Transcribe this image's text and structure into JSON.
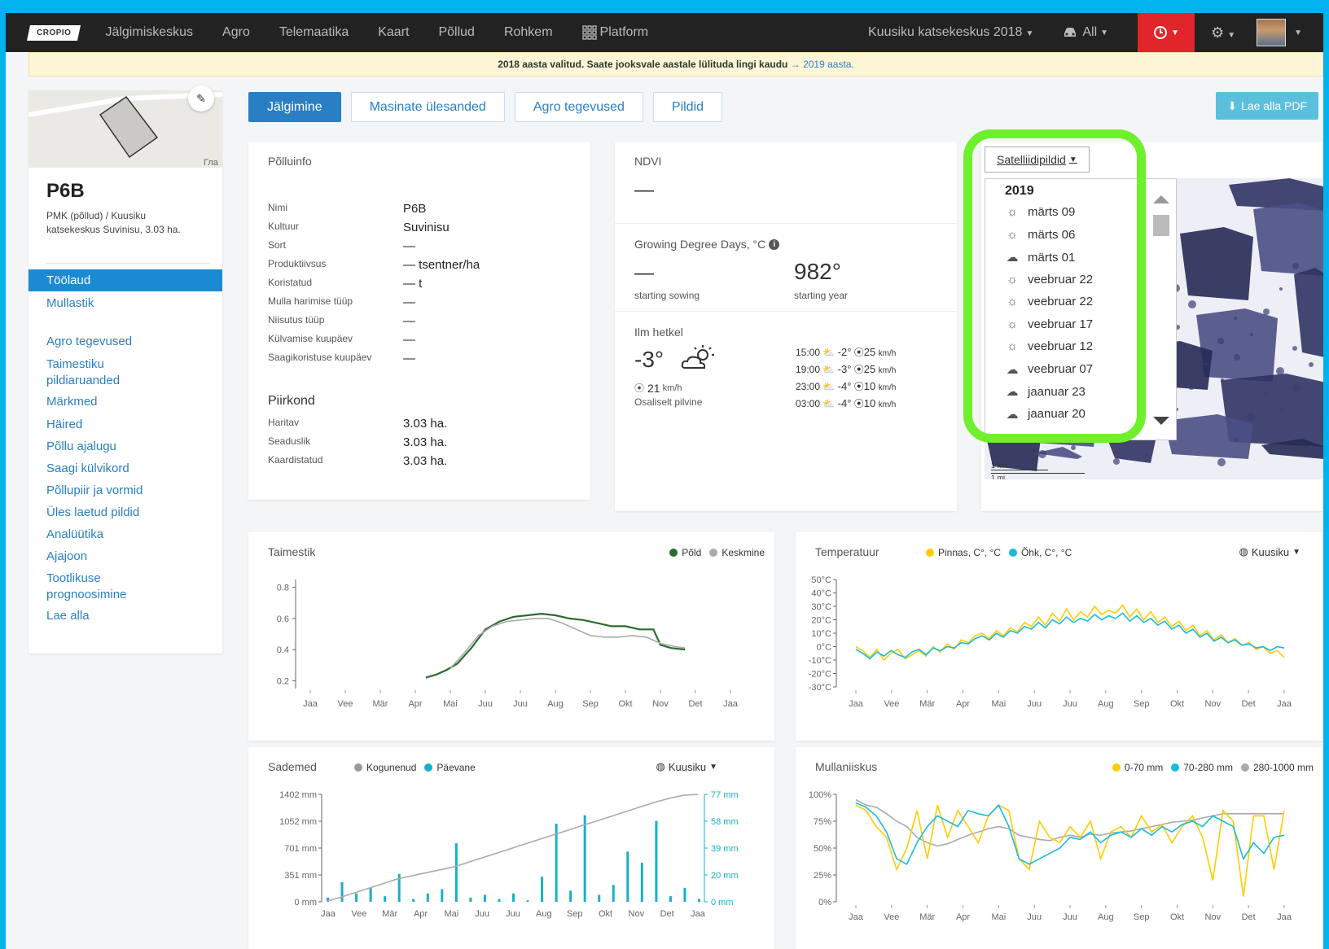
{
  "navbar": {
    "logo": "CROPIO",
    "items": [
      "Jälgimiskeskus",
      "Agro",
      "Telemaatika",
      "Kaart",
      "Põllud",
      "Rohkem"
    ],
    "platform": "Platform",
    "season": "Kuusiku katsekeskus 2018",
    "vehicles": "All"
  },
  "yearbar": {
    "text": "2018 aasta valitud. Saate jooksvale aastale lülituda lingi kaudu",
    "arrow": "→",
    "link": "2019 aasta."
  },
  "sidebar": {
    "field_name": "P6B",
    "subtitle": "PMK (põllud) / Kuusiku katsekeskus Suvinisu, 3.03 ha.",
    "map_label": "Гла",
    "menu": [
      "Töölaud",
      "Mullastik",
      "Agro tegevused",
      "Taimestiku pildiaruanded",
      "Märkmed",
      "Häired",
      "Põllu ajalugu",
      "Saagi külvikord",
      "Põllupiir ja vormid",
      "Üles laetud pildid",
      "Analüütika",
      "Ajajoon",
      "Tootlikuse prognoosimine",
      "Lae alla"
    ]
  },
  "tabs": [
    "Jälgimine",
    "Masinate ülesanded",
    "Agro tegevused",
    "Pildid"
  ],
  "pdf_button": "Lae alla PDF",
  "field_info": {
    "title": "Põlluinfo",
    "rows": [
      {
        "label": "Nimi",
        "value": "P6B"
      },
      {
        "label": "Kultuur",
        "value": "Suvinisu"
      },
      {
        "label": "Sort",
        "value": "—"
      },
      {
        "label": "Produktiivsus",
        "value": "— tsentner/ha"
      },
      {
        "label": "Koristatud",
        "value": "— t"
      },
      {
        "label": "Mulla harimise tüüp",
        "value": "—"
      },
      {
        "label": "Niisutus tüüp",
        "value": "—"
      },
      {
        "label": "Külvamise kuupäev",
        "value": "—"
      },
      {
        "label": "Saagikoristuse kuupäev",
        "value": "—"
      }
    ],
    "district_title": "Piirkond",
    "district_rows": [
      {
        "label": "Haritav",
        "value": "3.03 ha."
      },
      {
        "label": "Seaduslik",
        "value": "3.03 ha."
      },
      {
        "label": "Kaardistatud",
        "value": "3.03 ha."
      }
    ]
  },
  "ndvi": {
    "title": "NDVI",
    "value": "—",
    "gdd_title": "Growing Degree Days, °C",
    "gdd_sowing_value": "—",
    "gdd_sowing_label": "starting sowing",
    "gdd_year_value": "982°",
    "gdd_year_label": "starting year",
    "weather_title": "Ilm hetkel",
    "weather_temp": "-3°",
    "weather_wind": "21",
    "weather_wind_unit": "km/h",
    "weather_desc": "Osaliselt pilvine",
    "forecast": [
      {
        "time": "15:00",
        "temp": "-2°",
        "wind": "25",
        "unit": "km/h"
      },
      {
        "time": "19:00",
        "temp": "-3°",
        "wind": "25",
        "unit": "km/h"
      },
      {
        "time": "23:00",
        "temp": "-4°",
        "wind": "10",
        "unit": "km/h"
      },
      {
        "time": "03:00",
        "temp": "-4°",
        "wind": "10",
        "unit": "km/h"
      }
    ]
  },
  "satellite": {
    "button": "Satelliidipildid",
    "year": "2019",
    "items": [
      {
        "label": "märts 09",
        "icon": "sun-icon"
      },
      {
        "label": "märts 06",
        "icon": "sun-icon"
      },
      {
        "label": "märts 01",
        "icon": "cloud-icon"
      },
      {
        "label": "veebruar 22",
        "icon": "sun-icon"
      },
      {
        "label": "veebruar 22",
        "icon": "sun-icon"
      },
      {
        "label": "veebruar 17",
        "icon": "sun-icon"
      },
      {
        "label": "veebruar 12",
        "icon": "sun-icon"
      },
      {
        "label": "veebruar 07",
        "icon": "cloud-icon"
      },
      {
        "label": "jaanuar 23",
        "icon": "cloud-icon"
      },
      {
        "label": "jaanuar 20",
        "icon": "cloud-icon"
      }
    ],
    "scale_km": "1 km",
    "scale_mi": "1 mi",
    "highlight_color": "#6ef02d"
  },
  "chart_data": [
    {
      "type": "line",
      "title": "Taimestik",
      "series": [
        {
          "name": "Põld",
          "color": "#2e6b2e",
          "x": [
            3.3,
            3.6,
            3.9,
            4.2,
            4.6,
            5.0,
            5.4,
            5.8,
            6.2,
            6.6,
            7.0,
            7.4,
            7.8,
            8.2,
            8.6,
            9.0,
            9.4,
            9.8,
            10.0,
            10.3,
            10.7
          ],
          "values": [
            0.22,
            0.24,
            0.27,
            0.31,
            0.41,
            0.53,
            0.58,
            0.61,
            0.62,
            0.63,
            0.62,
            0.6,
            0.59,
            0.57,
            0.55,
            0.55,
            0.53,
            0.53,
            0.43,
            0.41,
            0.4
          ]
        },
        {
          "name": "Keskmine",
          "color": "#aaaaaa",
          "x": [
            4.0,
            4.4,
            4.8,
            5.2,
            5.6,
            6.0,
            6.4,
            6.8,
            7.2,
            7.6,
            8.0,
            8.4,
            8.8,
            9.2,
            9.6,
            10.0,
            10.4,
            10.7
          ],
          "values": [
            0.28,
            0.38,
            0.49,
            0.55,
            0.58,
            0.59,
            0.6,
            0.6,
            0.57,
            0.53,
            0.49,
            0.48,
            0.48,
            0.49,
            0.48,
            0.44,
            0.42,
            0.41
          ]
        }
      ],
      "categories": [
        "Jaa",
        "Vee",
        "Mär",
        "Apr",
        "Mai",
        "Juu",
        "Juu",
        "Aug",
        "Sep",
        "Okt",
        "Nov",
        "Det",
        "Jaa"
      ],
      "yticks": [
        0.2,
        0.4,
        0.6,
        0.8
      ],
      "ylim": [
        0.15,
        0.85
      ]
    },
    {
      "type": "line",
      "title": "Temperatuur",
      "location": "Kuusiku",
      "series": [
        {
          "name": "Pinnas, C°, °C",
          "color": "#ffcc00",
          "values": [
            0,
            -3,
            -8,
            -2,
            -10,
            -5,
            -2,
            -9,
            -6,
            -3,
            -7,
            0,
            -4,
            2,
            -2,
            5,
            3,
            8,
            10,
            6,
            12,
            8,
            14,
            11,
            18,
            15,
            22,
            16,
            25,
            19,
            28,
            20,
            26,
            22,
            30,
            24,
            27,
            25,
            31,
            22,
            28,
            20,
            26,
            18,
            22,
            15,
            19,
            12,
            16,
            8,
            12,
            5,
            9,
            3,
            6,
            1,
            3,
            -2,
            0,
            -5,
            -3,
            -8
          ]
        },
        {
          "name": "Õhk, C°, °C",
          "color": "#18bbdd",
          "values": [
            -2,
            -5,
            -9,
            -4,
            -7,
            -3,
            -6,
            -8,
            -4,
            -2,
            -6,
            -1,
            -3,
            0,
            -1,
            3,
            2,
            6,
            8,
            5,
            10,
            7,
            12,
            10,
            15,
            13,
            18,
            14,
            20,
            17,
            22,
            18,
            21,
            19,
            24,
            20,
            23,
            21,
            25,
            19,
            23,
            18,
            21,
            16,
            19,
            13,
            16,
            10,
            13,
            7,
            10,
            4,
            7,
            3,
            5,
            1,
            2,
            -1,
            0,
            -3,
            0,
            -1
          ]
        }
      ],
      "categories": [
        "Jaa",
        "Vee",
        "Mär",
        "Apr",
        "Mai",
        "Juu",
        "Juu",
        "Aug",
        "Sep",
        "Okt",
        "Nov",
        "Det",
        "Jaa"
      ],
      "yticks": [
        "-30°C",
        "-20°C",
        "-10°C",
        "0°C",
        "10°C",
        "20°C",
        "30°C",
        "40°C",
        "50°C"
      ],
      "ylim": [
        -30,
        50
      ]
    },
    {
      "type": "bar",
      "title": "Sademed",
      "location": "Kuusiku",
      "series": [
        {
          "name": "Kogunenud",
          "color": "#999999",
          "values": [
            5,
            60,
            120,
            180,
            240,
            300,
            340,
            380,
            420,
            460,
            520,
            580,
            640,
            700,
            760,
            820,
            880,
            940,
            1000,
            1060,
            1120,
            1180,
            1240,
            1300,
            1350,
            1390,
            1402
          ]
        },
        {
          "name": "Päevane",
          "color": "#18b0c8",
          "values": [
            3,
            14,
            6,
            10,
            4,
            20,
            2,
            6,
            9,
            42,
            3,
            5,
            2,
            6,
            1,
            18,
            56,
            8,
            62,
            5,
            12,
            36,
            28,
            58,
            4,
            10,
            2
          ]
        }
      ],
      "categories": [
        "Jaa",
        "Vee",
        "Mär",
        "Apr",
        "Mai",
        "Juu",
        "Juu",
        "Aug",
        "Sep",
        "Okt",
        "Nov",
        "Det",
        "Jaa"
      ],
      "yticks_left": [
        "0 mm",
        "351 mm",
        "701 mm",
        "1052 mm",
        "1402 mm"
      ],
      "yticks_right": [
        "0 mm",
        "20 mm",
        "39 mm",
        "58 mm",
        "77 mm"
      ]
    },
    {
      "type": "line",
      "title": "Mullaniiskus",
      "series": [
        {
          "name": "0-70 mm",
          "color": "#ffcc00",
          "values": [
            90,
            85,
            70,
            60,
            30,
            50,
            85,
            40,
            90,
            60,
            85,
            70,
            55,
            80,
            90,
            85,
            40,
            30,
            75,
            60,
            55,
            70,
            60,
            75,
            40,
            65,
            70,
            60,
            80,
            65,
            72,
            55,
            70,
            80,
            60,
            20,
            85,
            75,
            5,
            80,
            80,
            30,
            85
          ]
        },
        {
          "name": "70-280 mm",
          "color": "#18bbdd",
          "values": [
            92,
            88,
            80,
            65,
            40,
            35,
            55,
            70,
            80,
            75,
            70,
            85,
            82,
            80,
            90,
            70,
            40,
            35,
            40,
            45,
            50,
            60,
            58,
            65,
            55,
            62,
            65,
            60,
            68,
            62,
            70,
            65,
            72,
            75,
            70,
            80,
            75,
            70,
            40,
            55,
            45,
            60,
            62
          ]
        },
        {
          "name": "280-1000 mm",
          "color": "#aaaaaa",
          "values": [
            95,
            90,
            88,
            82,
            75,
            70,
            60,
            55,
            52,
            54,
            58,
            62,
            65,
            68,
            70,
            68,
            62,
            60,
            58,
            57,
            60,
            62,
            60,
            63,
            62,
            64,
            65,
            66,
            68,
            70,
            72,
            74,
            75,
            76,
            78,
            80,
            82,
            82,
            82,
            82,
            82,
            82,
            82
          ]
        }
      ],
      "categories": [
        "Jaa",
        "Vee",
        "Mär",
        "Apr",
        "Mai",
        "Juu",
        "Juu",
        "Aug",
        "Sep",
        "Okt",
        "Nov",
        "Det",
        "Jaa"
      ],
      "yticks": [
        "0%",
        "25%",
        "50%",
        "75%",
        "100%"
      ],
      "ylim": [
        0,
        100
      ]
    }
  ]
}
